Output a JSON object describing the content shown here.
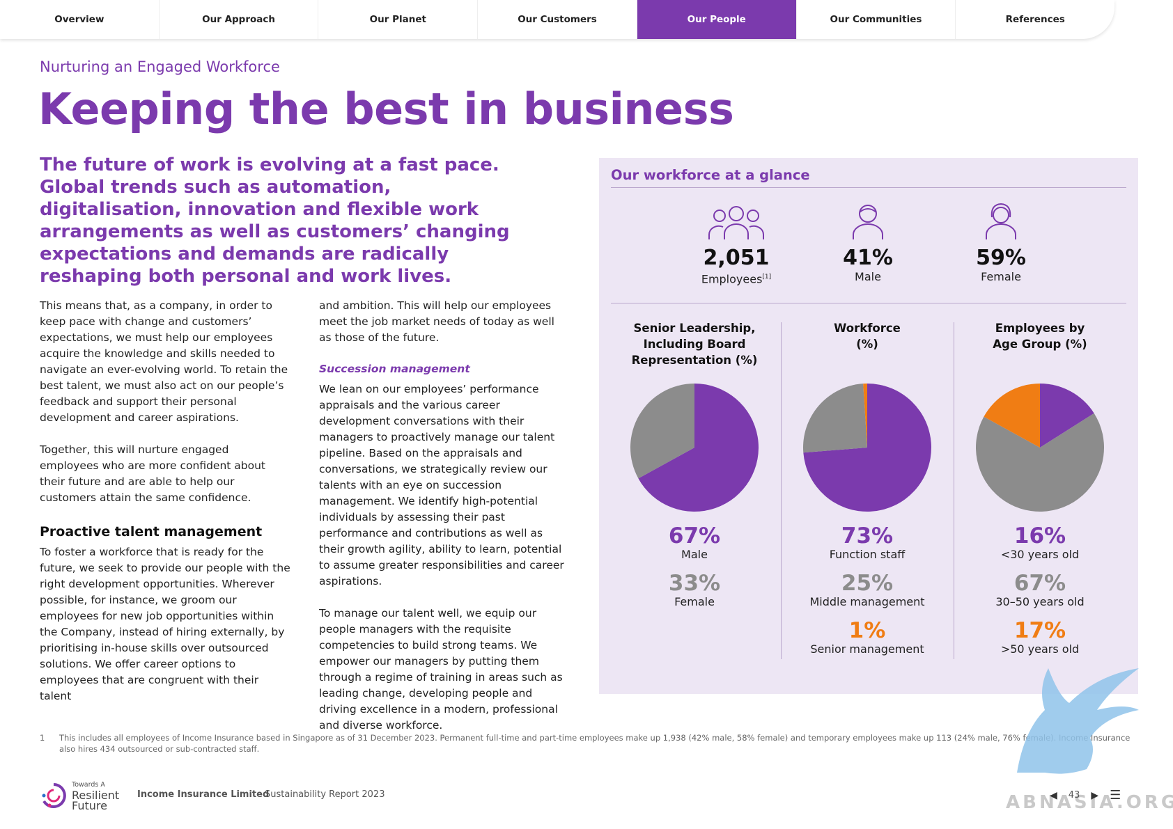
{
  "nav": {
    "items": [
      "Overview",
      "Our Approach",
      "Our Planet",
      "Our Customers",
      "Our People",
      "Our Communities",
      "References"
    ],
    "active_index": 4
  },
  "header": {
    "overline": "Nurturing an Engaged Workforce",
    "title": "Keeping the best in business",
    "lead": "The future of work is evolving at a fast pace. Global trends such as automation, digitalisation, innovation and flexible work arrangements as well as customers’ changing expectations and demands are radically reshaping both personal and work lives."
  },
  "body": {
    "col1": {
      "p1": "This means that, as a company, in order to keep pace with change and customers’ expectations, we must help our employees acquire the knowledge and skills needed to navigate an ever-evolving world. To retain the best talent, we must also act on our people’s feedback and support their personal development and career aspirations.",
      "p2": "Together, this will nurture engaged employees who are more confident about their future and are able to help our customers attain the same confidence.",
      "h1": "Proactive talent management",
      "p3": "To foster a workforce that is ready for the future, we seek to provide our people with the right development opportunities. Wherever possible, for instance, we groom our employees for new job opportunities within the Company, instead of hiring externally, by prioritising in-house skills over outsourced solutions. We offer career options to employees that are congruent with their talent"
    },
    "col2": {
      "p1": "and ambition. This will help our employees meet the job market needs of today as well as those of the future.",
      "h1": "Succession management",
      "p2": "We lean on our employees’ performance appraisals and the various career development conversations with their managers to proactively manage our talent pipeline. Based on the appraisals and conversations, we strategically review our talents with an eye on succession management. We identify high-potential individuals by assessing their past performance and contributions as well as their growth agility, ability to learn, potential to assume greater responsibilities and career aspirations.",
      "p3": "To manage our talent well, we equip our people managers with the requisite competencies to build strong teams. We empower our managers by putting them through a regime of training in areas such as leading change, developing people and driving excellence in a modern, professional and diverse workforce."
    }
  },
  "panel": {
    "title": "Our workforce at a glance",
    "stats": [
      {
        "icon": "people-group-icon",
        "value": "2,051",
        "label": "Employees",
        "sup": "[1]"
      },
      {
        "icon": "male-person-icon",
        "value": "41%",
        "label": "Male"
      },
      {
        "icon": "female-person-icon",
        "value": "59%",
        "label": "Female"
      }
    ],
    "pies": [
      {
        "heading_l1": "Senior Leadership,",
        "heading_l2": "Including Board",
        "heading_l3": "Representation (%)",
        "items": [
          {
            "value": "67%",
            "label": "Male",
            "color": "#7b3aad"
          },
          {
            "value": "33%",
            "label": "Female",
            "color": "#8c8c8c"
          }
        ]
      },
      {
        "heading_l1": "Workforce",
        "heading_l2": "(%)",
        "items": [
          {
            "value": "73%",
            "label": "Function staff",
            "color": "#7b3aad"
          },
          {
            "value": "25%",
            "label": "Middle management",
            "color": "#8c8c8c"
          },
          {
            "value": "1%",
            "label": "Senior management",
            "color": "#f07d14"
          }
        ]
      },
      {
        "heading_l1": "Employees by",
        "heading_l2": "Age Group (%)",
        "items": [
          {
            "value": "16%",
            "label": "<30 years old",
            "color": "#7b3aad"
          },
          {
            "value": "67%",
            "label": "30–50 years old",
            "color": "#8c8c8c"
          },
          {
            "value": "17%",
            "label": ">50 years old",
            "color": "#f07d14"
          }
        ]
      }
    ]
  },
  "chart_data": [
    {
      "type": "pie",
      "title": "Senior Leadership, Including Board Representation (%)",
      "categories": [
        "Male",
        "Female"
      ],
      "values": [
        67,
        33
      ],
      "colors": [
        "#7b3aad",
        "#8c8c8c"
      ]
    },
    {
      "type": "pie",
      "title": "Workforce (%)",
      "categories": [
        "Function staff",
        "Middle management",
        "Senior management"
      ],
      "values": [
        73,
        25,
        1
      ],
      "colors": [
        "#7b3aad",
        "#8c8c8c",
        "#f07d14"
      ]
    },
    {
      "type": "pie",
      "title": "Employees by Age Group (%)",
      "categories": [
        "<30 years old",
        "30–50 years old",
        ">50 years old"
      ],
      "values": [
        16,
        67,
        17
      ],
      "colors": [
        "#7b3aad",
        "#8c8c8c",
        "#f07d14"
      ]
    }
  ],
  "footnote": {
    "num": "1",
    "text": "This includes all employees of Income Insurance based in Singapore as of 31 December 2023. Permanent full-time and part-time employees make up 1,938 (42% male, 58% female) and temporary employees make up 113 (24% male, 76% female). Income Insurance also hires 434 outsourced or sub-contracted staff."
  },
  "footer": {
    "logo_small": "Towards A",
    "logo_l1": "Resilient",
    "logo_l2": "Future",
    "company": "Income Insurance Limited",
    "report": "Sustainability Report 2023",
    "page": "43",
    "prev_icon": "triangle-left-icon",
    "next_icon": "triangle-right-icon",
    "menu_icon": "menu-icon"
  },
  "watermark": "ABNASIA.ORG"
}
